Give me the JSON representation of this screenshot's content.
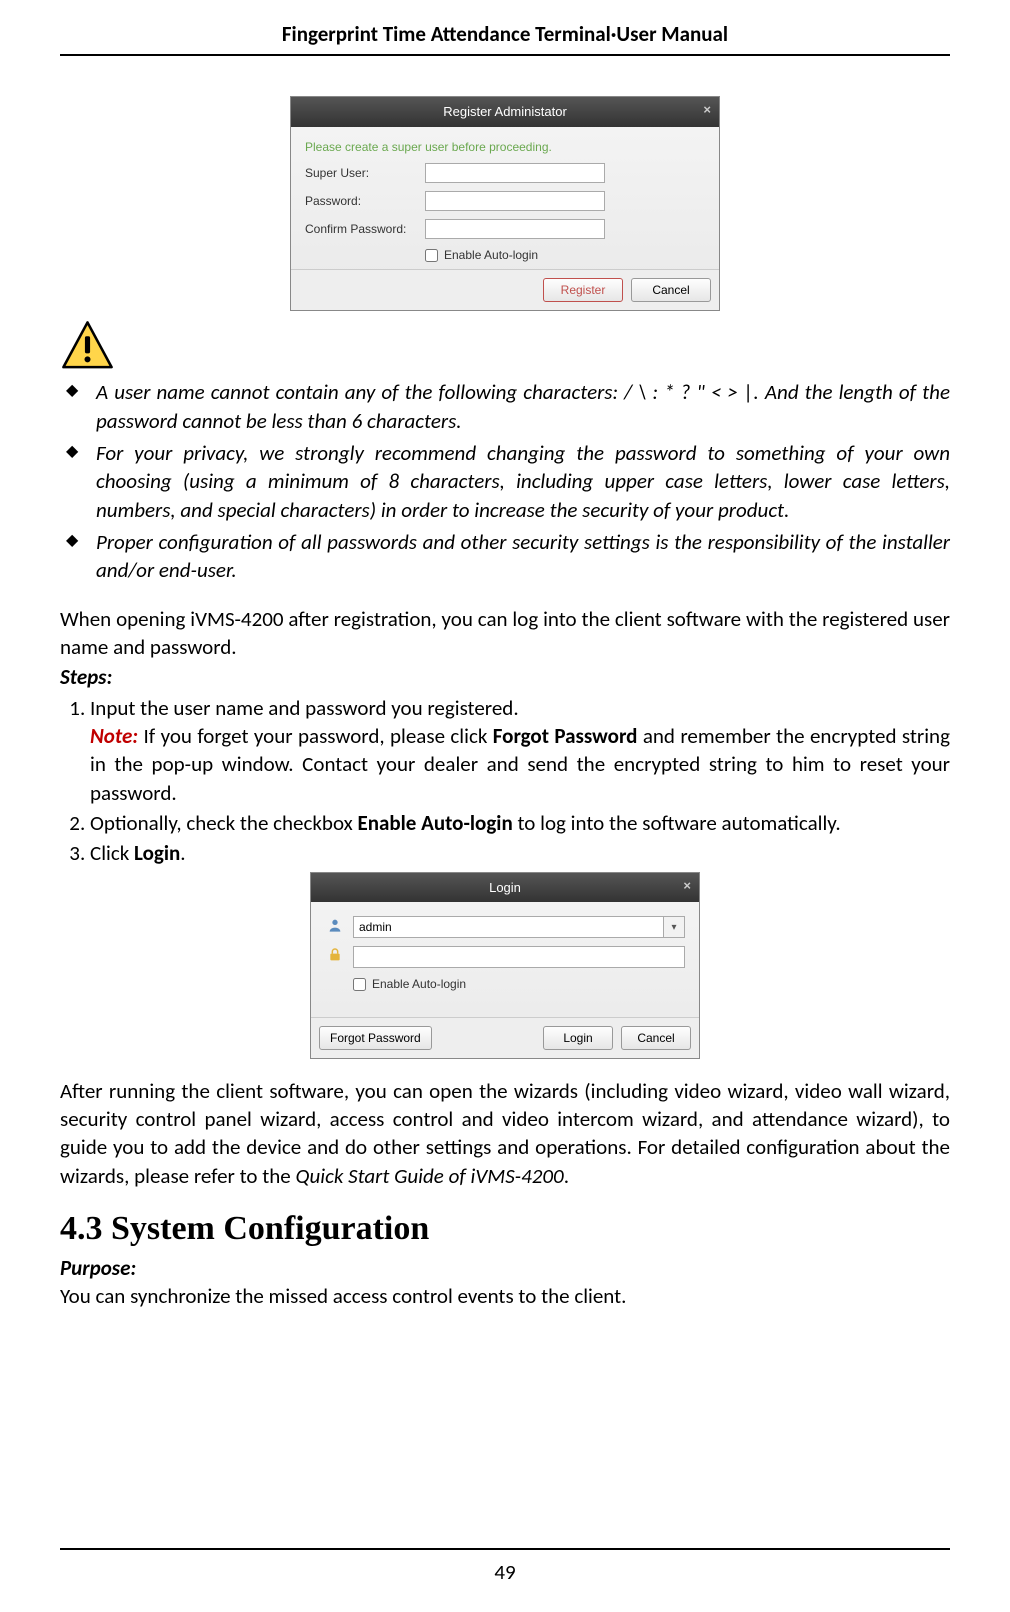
{
  "header": {
    "title": "Fingerprint Time Attendance Terminal·User Manual"
  },
  "page_number": "49",
  "dialog_register": {
    "title": "Register Administator",
    "instruction": "Please create a super user before proceeding.",
    "field_super_user": "Super User:",
    "field_password": "Password:",
    "field_confirm": "Confirm Password:",
    "checkbox_label": "Enable Auto-login",
    "btn_register": "Register",
    "btn_cancel": "Cancel"
  },
  "bullets": {
    "b1": "A user name cannot contain any of the following characters: / \\ : * ? \" < > |. And the length of the password cannot be less than 6 characters.",
    "b2": "For your privacy, we strongly recommend changing the password to something of your own choosing (using a minimum of 8 characters, including upper case letters, lower case letters, numbers, and special characters) in order to increase the security of your product.",
    "b3": "Proper configuration of all passwords and other security settings is the responsibility of the installer and/or end-user."
  },
  "para_after_bullets": "When opening iVMS-4200 after registration, you can log into the client software with the registered user name and password.",
  "steps_label": "Steps:",
  "steps": {
    "s1": "Input the user name and password you registered.",
    "note_label": "Note:",
    "note_text_a": " If you forget your password, please click ",
    "note_bold": "Forgot Password",
    "note_text_b": " and remember the encrypted string in the pop-up window. Contact your dealer and send the encrypted string to him to reset your password.",
    "s2a": "Optionally, check the checkbox ",
    "s2_bold": "Enable Auto-login",
    "s2b": " to log into the software automatically.",
    "s3a": "Click ",
    "s3_bold": "Login",
    "s3b": "."
  },
  "dialog_login": {
    "title": "Login",
    "username_value": "admin",
    "checkbox_label": "Enable Auto-login",
    "btn_forgot": "Forgot Password",
    "btn_login": "Login",
    "btn_cancel": "Cancel"
  },
  "para_after_login_a": "After running the client software, you can open the wizards (including video wizard, video wall wizard, security control panel wizard, access control and video intercom wizard, and attendance wizard), to guide you to add the device and do other settings and operations. For detailed configuration about the wizards, please refer to the ",
  "para_after_login_ital": "Quick Start Guide of iVMS-4200",
  "para_after_login_b": ".",
  "section_heading": "4.3  System Configuration",
  "purpose_label": "Purpose:",
  "purpose_text": "You can synchronize the missed access control events to the client."
}
